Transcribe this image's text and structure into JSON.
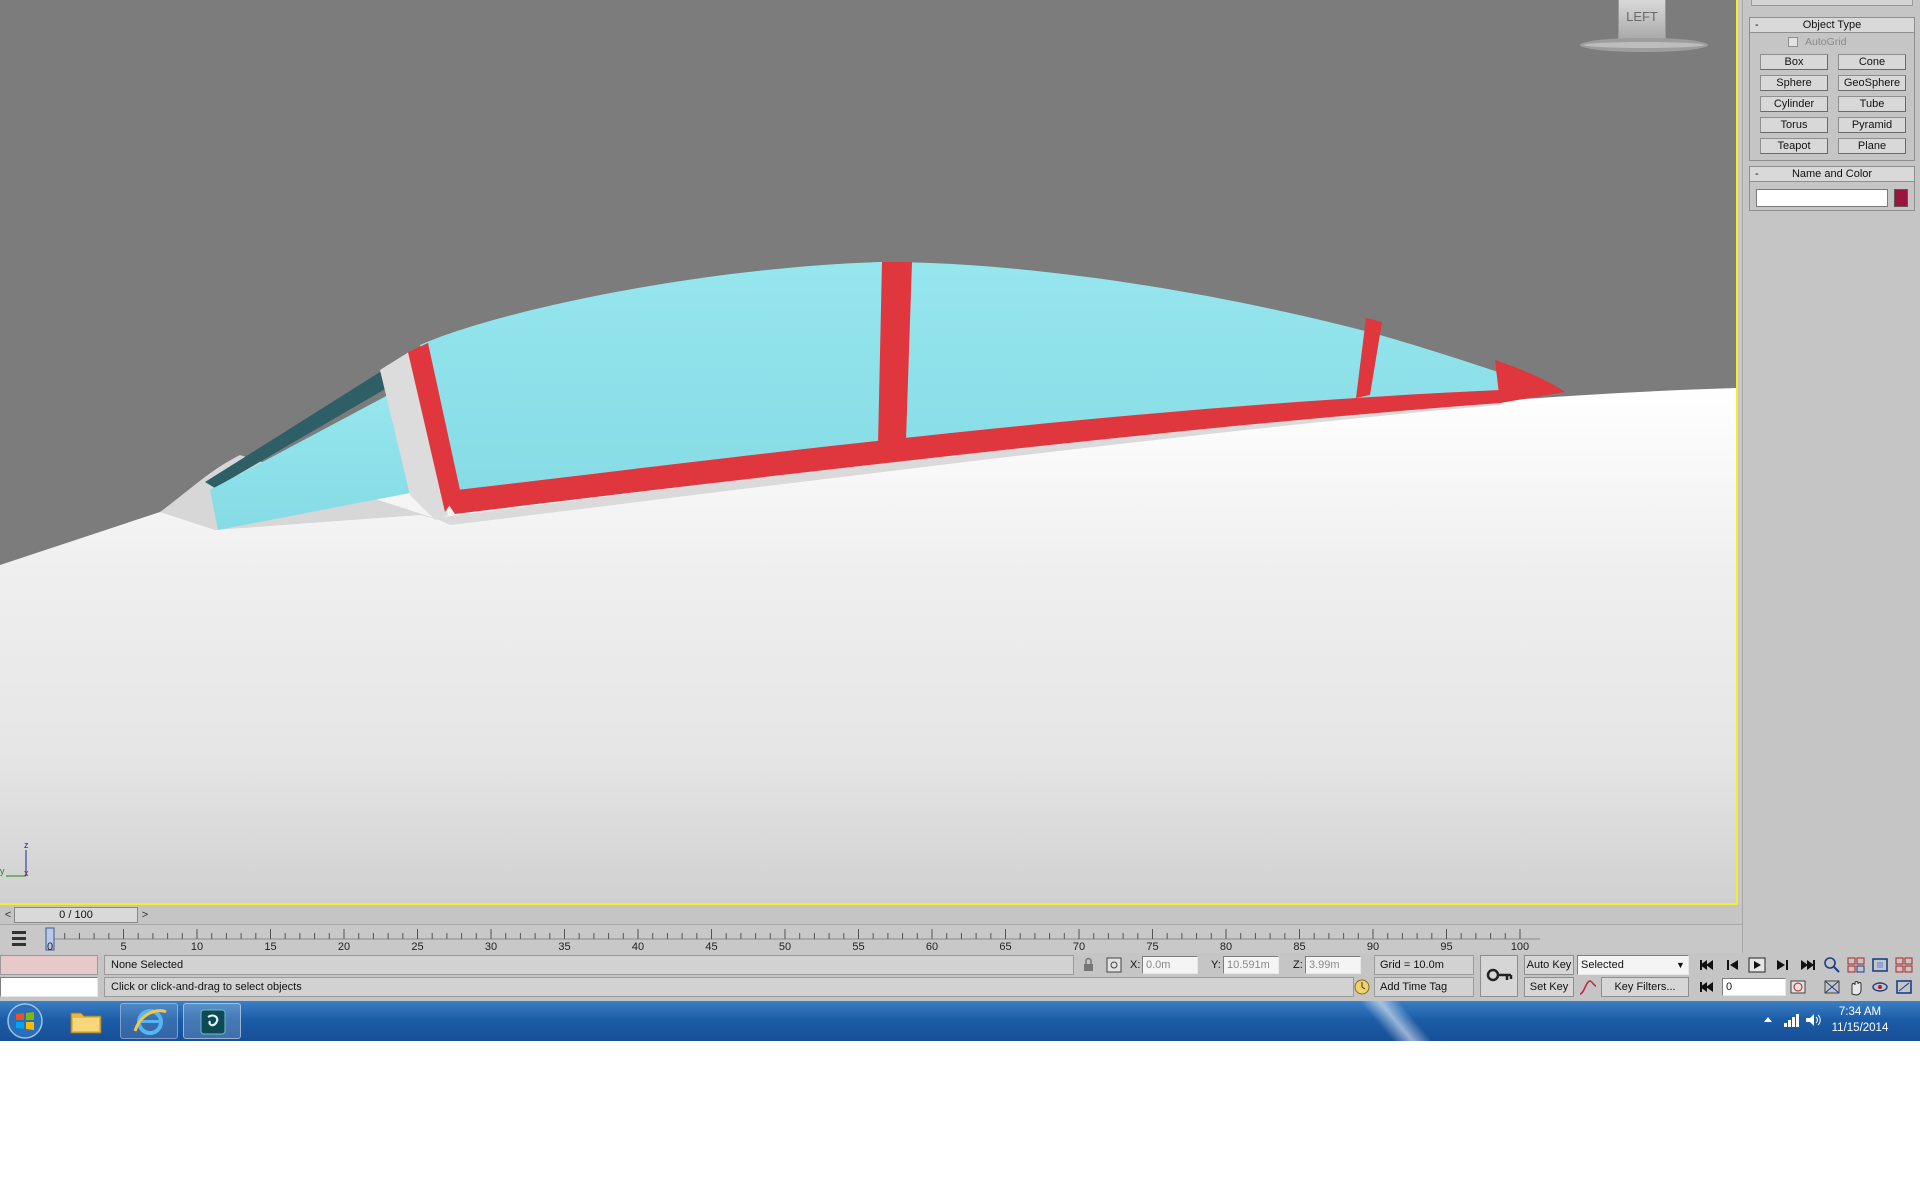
{
  "viewport": {
    "viewcube_label": "LEFT",
    "axis_labels": {
      "z": "z",
      "y": "y",
      "x": "x"
    }
  },
  "command_panel": {
    "object_type_title": "Object Type",
    "autogrid_label": "AutoGrid",
    "buttons": [
      "Box",
      "Cone",
      "Sphere",
      "GeoSphere",
      "Cylinder",
      "Tube",
      "Torus",
      "Pyramid",
      "Teapot",
      "Plane"
    ],
    "name_color_title": "Name and Color",
    "object_color": "#9b1440"
  },
  "time_slider": {
    "prev": "<",
    "position": "0 / 100",
    "next": ">"
  },
  "trackbar": {
    "tick_labels": [
      "0",
      "5",
      "10",
      "15",
      "20",
      "25",
      "30",
      "35",
      "40",
      "45",
      "50",
      "55",
      "60",
      "65",
      "70",
      "75",
      "80",
      "85",
      "90",
      "95",
      "100"
    ]
  },
  "status_bar": {
    "selection": "None Selected",
    "prompt": "Click or click-and-drag to select objects",
    "x_value": "0.0m",
    "y_value": "10.591m",
    "z_value": "3.99m",
    "grid": "Grid = 10.0m",
    "add_time_tag": "Add Time Tag",
    "auto_key": "Auto Key",
    "set_key": "Set Key",
    "key_mode": "Selected",
    "key_filters": "Key Filters...",
    "current_frame": "0"
  },
  "taskbar": {
    "time": "7:34 AM",
    "date": "11/15/2014"
  },
  "colors": {
    "canopy_glass": "#8fe4ec",
    "canopy_frame": "#e0363d",
    "viewport_border": "#f3ee2c"
  }
}
